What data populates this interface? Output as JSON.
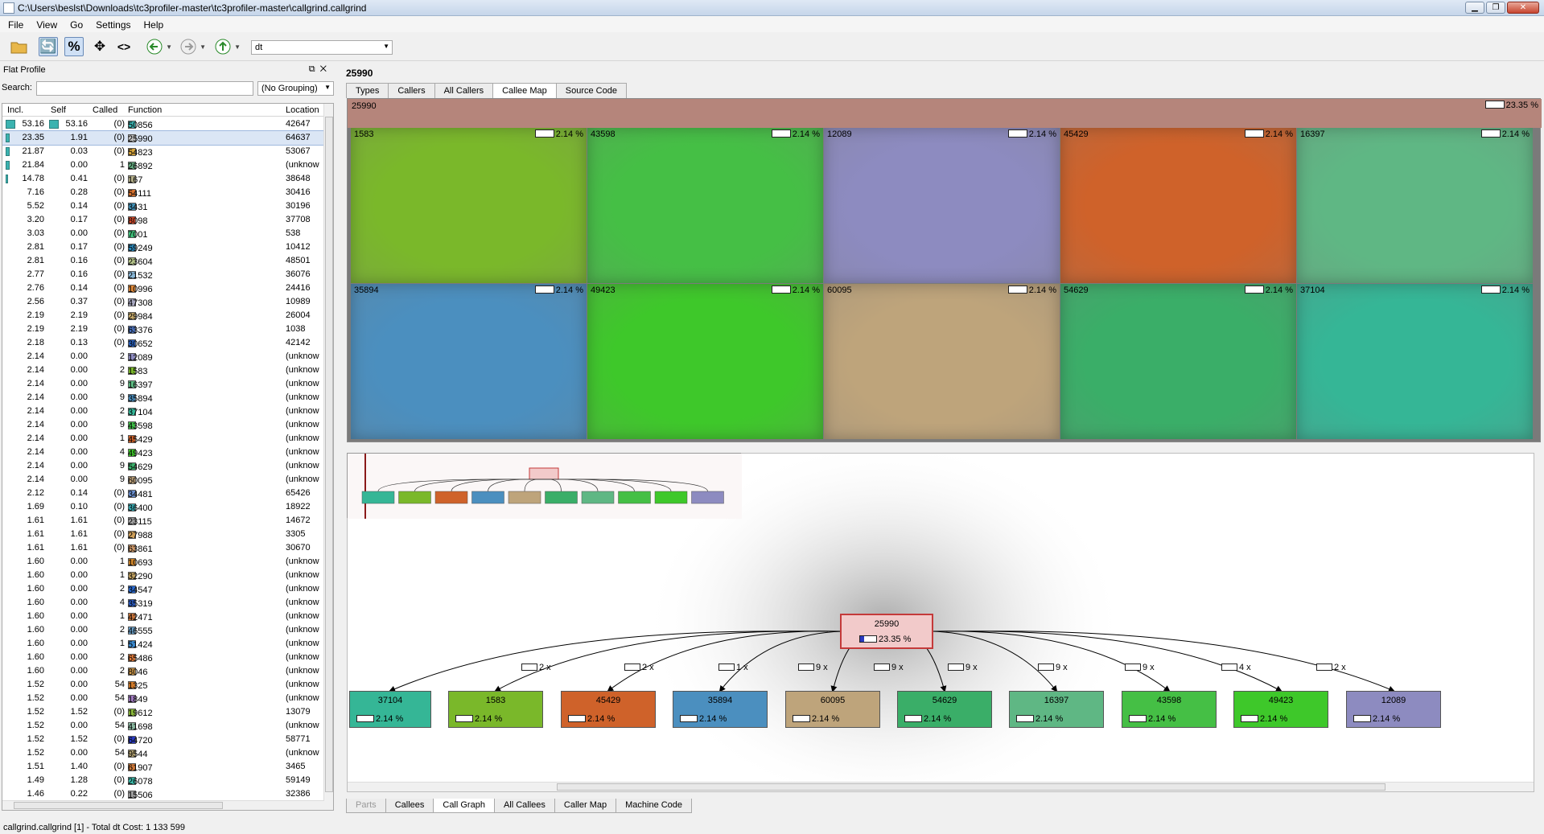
{
  "window": {
    "title": "C:\\Users\\beslst\\Downloads\\tc3profiler-master\\tc3profiler-master\\callgrind.callgrind"
  },
  "menu": [
    "File",
    "View",
    "Go",
    "Settings",
    "Help"
  ],
  "toolbar": {
    "event_combo": "dt"
  },
  "dock": {
    "title": "Flat Profile",
    "search_label": "Search:",
    "search_value": "",
    "grouping": "(No Grouping)"
  },
  "table": {
    "headers": {
      "incl": "Incl.",
      "self": "Self",
      "called": "Called",
      "function": "Function",
      "location": "Location"
    },
    "rows": [
      {
        "incl": "53.16",
        "self": "53.16",
        "called": "(0)",
        "func": "50856",
        "loc": "42647",
        "color": "#3bb3b0"
      },
      {
        "incl": "23.35",
        "self": "1.91",
        "called": "(0)",
        "func": "25990",
        "loc": "64637",
        "color": "#c0c0c0"
      },
      {
        "incl": "21.87",
        "self": "0.03",
        "called": "(0)",
        "func": "54823",
        "loc": "53067",
        "color": "#d9a63b"
      },
      {
        "incl": "21.84",
        "self": "0.00",
        "called": "1",
        "func": "26892",
        "loc": "(unknow",
        "color": "#62a97e"
      },
      {
        "incl": "14.78",
        "self": "0.41",
        "called": "(0)",
        "func": "167",
        "loc": "38648",
        "color": "#b5b08a"
      },
      {
        "incl": "7.16",
        "self": "0.28",
        "called": "(0)",
        "func": "54111",
        "loc": "30416",
        "color": "#d8722e"
      },
      {
        "incl": "5.52",
        "self": "0.14",
        "called": "(0)",
        "func": "3431",
        "loc": "30196",
        "color": "#3f8fb5"
      },
      {
        "incl": "3.20",
        "self": "0.17",
        "called": "(0)",
        "func": "8098",
        "loc": "37708",
        "color": "#d84d2d"
      },
      {
        "incl": "3.03",
        "self": "0.00",
        "called": "(0)",
        "func": "7001",
        "loc": "538",
        "color": "#3fc07a"
      },
      {
        "incl": "2.81",
        "self": "0.17",
        "called": "(0)",
        "func": "59249",
        "loc": "10412",
        "color": "#2a86b8"
      },
      {
        "incl": "2.81",
        "self": "0.16",
        "called": "(0)",
        "func": "23604",
        "loc": "48501",
        "color": "#b5c48a"
      },
      {
        "incl": "2.77",
        "self": "0.16",
        "called": "(0)",
        "func": "21532",
        "loc": "36076",
        "color": "#8ab8d8"
      },
      {
        "incl": "2.76",
        "self": "0.14",
        "called": "(0)",
        "func": "10996",
        "loc": "24416",
        "color": "#e0893a"
      },
      {
        "incl": "2.56",
        "self": "0.37",
        "called": "(0)",
        "func": "47308",
        "loc": "10989",
        "color": "#a8a8c0"
      },
      {
        "incl": "2.19",
        "self": "2.19",
        "called": "(0)",
        "func": "29984",
        "loc": "26004",
        "color": "#c4a86a"
      },
      {
        "incl": "2.19",
        "self": "2.19",
        "called": "(0)",
        "func": "63376",
        "loc": "1038",
        "color": "#4a6fb8"
      },
      {
        "incl": "2.18",
        "self": "0.13",
        "called": "(0)",
        "func": "30652",
        "loc": "42142",
        "color": "#2a62c0"
      },
      {
        "incl": "2.14",
        "self": "0.00",
        "called": "2",
        "func": "12089",
        "loc": "(unknow",
        "color": "#8d8bc0"
      },
      {
        "incl": "2.14",
        "self": "0.00",
        "called": "2",
        "func": "1583",
        "loc": "(unknow",
        "color": "#7ab82a"
      },
      {
        "incl": "2.14",
        "self": "0.00",
        "called": "9",
        "func": "16397",
        "loc": "(unknow",
        "color": "#5fbf85"
      },
      {
        "incl": "2.14",
        "self": "0.00",
        "called": "9",
        "func": "35894",
        "loc": "(unknow",
        "color": "#4a8fc0"
      },
      {
        "incl": "2.14",
        "self": "0.00",
        "called": "2",
        "func": "37104",
        "loc": "(unknow",
        "color": "#35b89a"
      },
      {
        "incl": "2.14",
        "self": "0.00",
        "called": "9",
        "func": "43598",
        "loc": "(unknow",
        "color": "#3fbf48"
      },
      {
        "incl": "2.14",
        "self": "0.00",
        "called": "1",
        "func": "45429",
        "loc": "(unknow",
        "color": "#d0622a"
      },
      {
        "incl": "2.14",
        "self": "0.00",
        "called": "4",
        "func": "49423",
        "loc": "(unknow",
        "color": "#3ec82a"
      },
      {
        "incl": "2.14",
        "self": "0.00",
        "called": "9",
        "func": "54629",
        "loc": "(unknow",
        "color": "#3aaf6a"
      },
      {
        "incl": "2.14",
        "self": "0.00",
        "called": "9",
        "func": "60095",
        "loc": "(unknow",
        "color": "#c0a47c"
      },
      {
        "incl": "2.12",
        "self": "0.14",
        "called": "(0)",
        "func": "34481",
        "loc": "65426",
        "color": "#6a8fd0"
      },
      {
        "incl": "1.69",
        "self": "0.10",
        "called": "(0)",
        "func": "36400",
        "loc": "18922",
        "color": "#3ab0b8"
      },
      {
        "incl": "1.61",
        "self": "1.61",
        "called": "(0)",
        "func": "23115",
        "loc": "14672",
        "color": "#a0a0a0"
      },
      {
        "incl": "1.61",
        "self": "1.61",
        "called": "(0)",
        "func": "27988",
        "loc": "3305",
        "color": "#d0a05a"
      },
      {
        "incl": "1.61",
        "self": "1.61",
        "called": "(0)",
        "func": "63861",
        "loc": "30670",
        "color": "#d09a6a"
      },
      {
        "incl": "1.60",
        "self": "0.00",
        "called": "1",
        "func": "10693",
        "loc": "(unknow",
        "color": "#d0862a"
      },
      {
        "incl": "1.60",
        "self": "0.00",
        "called": "1",
        "func": "32290",
        "loc": "(unknow",
        "color": "#c0a060"
      },
      {
        "incl": "1.60",
        "self": "0.00",
        "called": "2",
        "func": "34547",
        "loc": "(unknow",
        "color": "#2a6ad0"
      },
      {
        "incl": "1.60",
        "self": "0.00",
        "called": "4",
        "func": "35319",
        "loc": "(unknow",
        "color": "#2a5ac0"
      },
      {
        "incl": "1.60",
        "self": "0.00",
        "called": "1",
        "func": "42471",
        "loc": "(unknow",
        "color": "#c8743a"
      },
      {
        "incl": "1.60",
        "self": "0.00",
        "called": "2",
        "func": "46555",
        "loc": "(unknow",
        "color": "#6aa0c8"
      },
      {
        "incl": "1.60",
        "self": "0.00",
        "called": "1",
        "func": "51424",
        "loc": "(unknow",
        "color": "#3a8ad0"
      },
      {
        "incl": "1.60",
        "self": "0.00",
        "called": "2",
        "func": "65486",
        "loc": "(unknow",
        "color": "#e07a3a"
      },
      {
        "incl": "1.60",
        "self": "0.00",
        "called": "2",
        "func": "8046",
        "loc": "(unknow",
        "color": "#d09a4a"
      },
      {
        "incl": "1.52",
        "self": "0.00",
        "called": "54",
        "func": "1325",
        "loc": "(unknow",
        "color": "#d07a2a"
      },
      {
        "incl": "1.52",
        "self": "0.00",
        "called": "54",
        "func": "1849",
        "loc": "(unknow",
        "color": "#a07ac0"
      },
      {
        "incl": "1.52",
        "self": "1.52",
        "called": "(0)",
        "func": "19612",
        "loc": "13079",
        "color": "#8ab83a"
      },
      {
        "incl": "1.52",
        "self": "0.00",
        "called": "54",
        "func": "41698",
        "loc": "(unknow",
        "color": "#8ab8a0"
      },
      {
        "incl": "1.52",
        "self": "1.52",
        "called": "(0)",
        "func": "64720",
        "loc": "58771",
        "color": "#2a3ac0"
      },
      {
        "incl": "1.52",
        "self": "0.00",
        "called": "54",
        "func": "9544",
        "loc": "(unknow",
        "color": "#b0a070"
      },
      {
        "incl": "1.51",
        "self": "1.40",
        "called": "(0)",
        "func": "61907",
        "loc": "3465",
        "color": "#d07a3a"
      },
      {
        "incl": "1.49",
        "self": "1.28",
        "called": "(0)",
        "func": "26078",
        "loc": "59149",
        "color": "#3ab8a8"
      },
      {
        "incl": "1.46",
        "self": "0.22",
        "called": "(0)",
        "func": "15506",
        "loc": "32386",
        "color": "#a0a0a0"
      }
    ]
  },
  "status": "callgrind.callgrind [1] - Total dt Cost: 1 133 599",
  "right": {
    "function_name": "25990",
    "tabs": [
      "Types",
      "Callers",
      "All Callers",
      "Callee Map",
      "Source Code"
    ],
    "active_tab": "Callee Map",
    "bottom_tabs": [
      "Parts",
      "Callees",
      "Call Graph",
      "All Callees",
      "Caller Map",
      "Machine Code"
    ],
    "active_bottom_tab": "Call Graph"
  },
  "callee_map": {
    "root": {
      "name": "25990",
      "pct": "23.35 %",
      "color": "#b5857b"
    },
    "cells": [
      {
        "name": "1583",
        "pct": "2.14 %",
        "color": "#7ab82a"
      },
      {
        "name": "43598",
        "pct": "2.14 %",
        "color": "#45bf45"
      },
      {
        "name": "12089",
        "pct": "2.14 %",
        "color": "#8d8bc0"
      },
      {
        "name": "45429",
        "pct": "2.14 %",
        "color": "#cf622a"
      },
      {
        "name": "16397",
        "pct": "2.14 %",
        "color": "#5fb784"
      },
      {
        "name": "35894",
        "pct": "2.14 %",
        "color": "#4b8fbf"
      },
      {
        "name": "49423",
        "pct": "2.14 %",
        "color": "#3ec82a"
      },
      {
        "name": "60095",
        "pct": "2.14 %",
        "color": "#bea47b"
      },
      {
        "name": "54629",
        "pct": "2.14 %",
        "color": "#3aae68"
      },
      {
        "name": "37104",
        "pct": "2.14 %",
        "color": "#35b696"
      }
    ]
  },
  "call_graph": {
    "root": {
      "name": "25990",
      "pct": "23.35 %",
      "color": "#f0c8c8"
    },
    "edges": [
      "2 x",
      "2 x",
      "1 x",
      "9 x",
      "9 x",
      "9 x",
      "9 x",
      "9 x",
      "4 x",
      "2 x"
    ],
    "nodes": [
      {
        "name": "37104",
        "pct": "2.14 %",
        "color": "#35b696"
      },
      {
        "name": "1583",
        "pct": "2.14 %",
        "color": "#7ab82a"
      },
      {
        "name": "45429",
        "pct": "2.14 %",
        "color": "#cf622a"
      },
      {
        "name": "35894",
        "pct": "2.14 %",
        "color": "#4b8fbf"
      },
      {
        "name": "60095",
        "pct": "2.14 %",
        "color": "#bea47b"
      },
      {
        "name": "54629",
        "pct": "2.14 %",
        "color": "#3aae68"
      },
      {
        "name": "16397",
        "pct": "2.14 %",
        "color": "#5fb784"
      },
      {
        "name": "43598",
        "pct": "2.14 %",
        "color": "#45bf45"
      },
      {
        "name": "49423",
        "pct": "2.14 %",
        "color": "#3ec82a"
      },
      {
        "name": "12089",
        "pct": "2.14 %",
        "color": "#8d8bc0"
      }
    ]
  }
}
